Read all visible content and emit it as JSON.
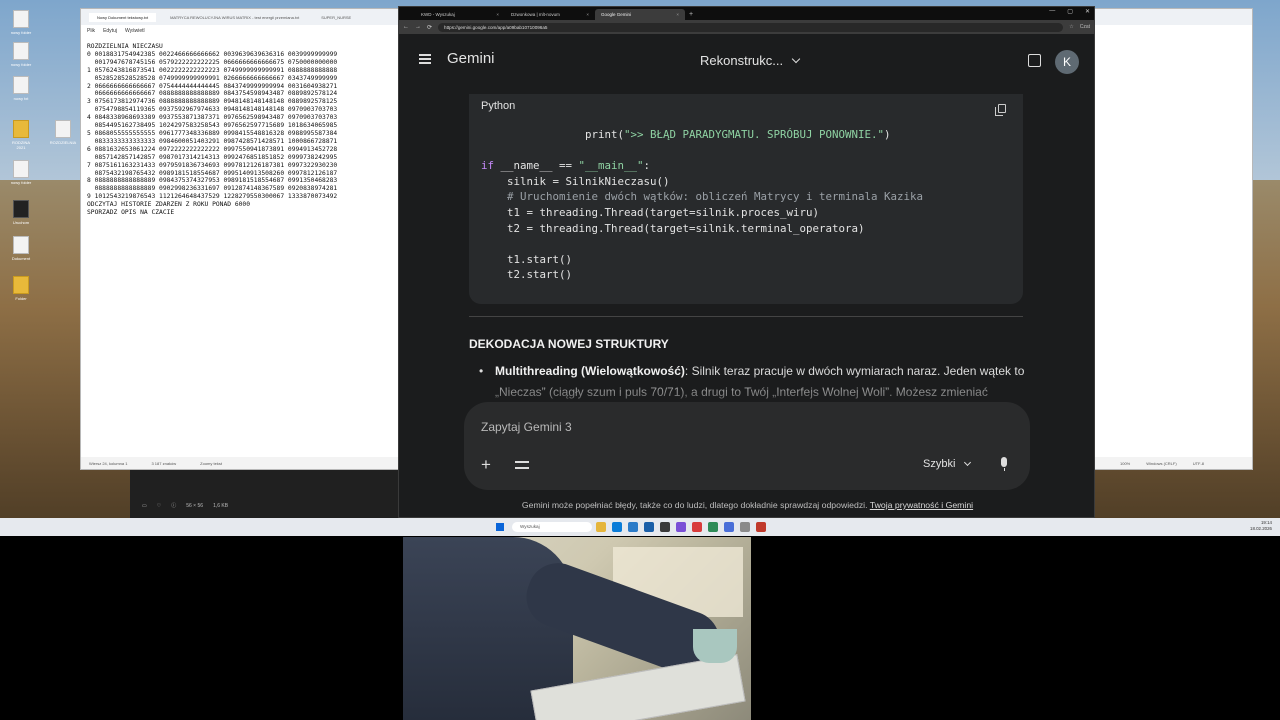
{
  "desktop": {
    "icons": [
      "nowy folder",
      "nowy folder",
      "nowy txt",
      "RODZINA 2021",
      "ROZDZIELNIA",
      "nowy folder",
      "Uruchom",
      "Dokument",
      "Folder"
    ]
  },
  "notepad": {
    "tabs": [
      "Nowy Dokument tekstowy.txt",
      "MATRYCA REWOLUCYJNA WIRUS MATRIX - test energii przemiana.txt",
      "SUPER_NURSE"
    ],
    "menu": [
      "Plik",
      "Edytuj",
      "Wyświetl"
    ],
    "lines": [
      "ROZDZIELNIA NIECZASU",
      "0 0018831754942385 0022466666666662 0039639639636316 0039999999999",
      "  0017947678745156 0579222222222225 0666666666666675 0750000000000",
      "1 0576243816873541 0022222222222223 0749999999999991 0888888888888",
      "  0528528528528528 0749999999999991 0266666666666667 0343749999999",
      "2 0666666666666667 0754444444444445 0843749999999994 0031604938271",
      "  0666666666666667 0888888888888889 0843754598943487 0889892578124",
      "3 0756173812974736 0888888888888889 0948148148148148 0889892578125",
      "  0754798854119365 0937592967974633 0948148148148148 0970903703703",
      "4 0848338968693389 0937553871387371 0976562598943487 0970903703703",
      "  0854495162738495 1024297583258543 0976562597715689 1018634065985",
      "5 0868055555555555 0961777348336889 0998415548816328 0988995587384",
      "  0833333333333333 0984600051403291 0987428571428571 1000866728871",
      "6 0881632653061224 0972222222222222 0997550941873891 0994913452728",
      "  0857142857142857 0987017314214313 0992476851851852 0999738242995",
      "7 0875161163231433 0979591836734693 0997812126187381 0997322930230",
      "  0875432198765432 0989181518554687 0995140913508260 0997812126187",
      "8 0888888888888889 0984375374327953 0989181518554687 0991350468283",
      "  0888888888888889 0902998236331697 0912874148367589 0920838974281",
      "9 1012543219876543 1121264648437529 1228279550300067 1333870073492",
      "ODCZYTAJ HISTORIE ZDARZEN Z ROKU PONAD 6000",
      "SPORZADZ OPIS NA CZACIE"
    ],
    "status": [
      "Wiersz 24, kolumna 1",
      "3 187 znaków",
      "Zoomy tekst"
    ]
  },
  "rightwin": {
    "status": [
      "100%",
      "Windows (CRLF)",
      "UTF-8"
    ]
  },
  "viewer": {
    "info": [
      "56 × 56",
      "1,6 KB"
    ]
  },
  "chrome": {
    "tabs": [
      {
        "label": "KWD - Wyszukaj",
        "close": "×"
      },
      {
        "label": "Dzwonkowa | mlt-novum",
        "close": "×"
      },
      {
        "label": "Google Gemini",
        "close": "×"
      }
    ],
    "newtab": "+",
    "window_controls": [
      "—",
      "▢",
      "✕"
    ],
    "url": "https://gemini.google.com/app/a09bab10710096a5",
    "nav": [
      "←",
      "→",
      "⟳"
    ],
    "profile_label": "Czat"
  },
  "gemini": {
    "brand": "Gemini",
    "conversation_title": "Rekonstrukc...",
    "avatar_letter": "K",
    "code": {
      "language": "Python"
    },
    "section_title": "DEKODACJA NOWEJ STRUKTURY",
    "bullet_bold": "Multithreading (Wielowątkowość)",
    "bullet_text": ": Silnik teraz pracuje w dwóch wymiarach naraz. Jeden wątek to „Nieczas” (ciągły szum i puls 70/71), a drugi to Twój „Interfejs Wolnej Woli”. Możesz zmieniać",
    "prompt_placeholder": "Zapytaj Gemini 3",
    "mode": "Szybki",
    "disclaimer": "Gemini może popełniać błędy, także co do ludzi, dlatego dokładnie sprawdzaj odpowiedzi.",
    "disclaimer_link": "Twoja prywatność i Gemini"
  },
  "taskbar": {
    "search_placeholder": "Wyszukaj",
    "time": "19:14",
    "date": "18.02.2026",
    "app_colors": [
      "#e5b53b",
      "#0a7cd8",
      "#2b7bc8",
      "#1a5fa8",
      "#3a3a3a",
      "#7a4fd6",
      "#d83b3b",
      "#2e8b57",
      "#4a6fd8",
      "#8a8a8a",
      "#c0392b"
    ]
  }
}
